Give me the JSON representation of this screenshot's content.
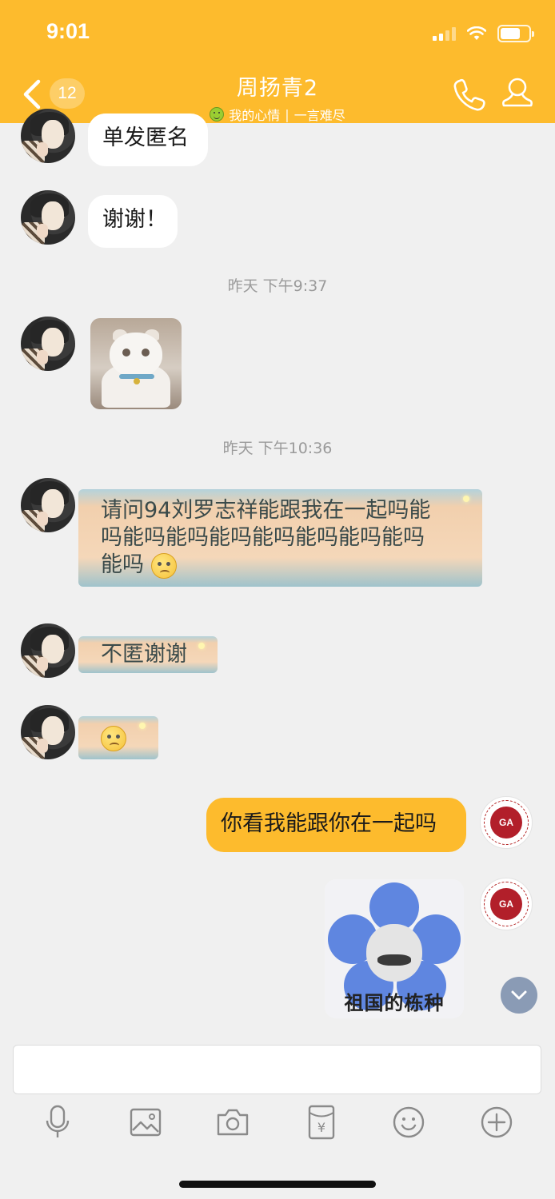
{
  "status_bar": {
    "time": "9:01",
    "battery_level": 0.72
  },
  "header": {
    "unread_count": "12",
    "title": "周扬青2",
    "subtitle_mood": "我的心情",
    "subtitle_separator": "|",
    "subtitle_status": "一言难尽"
  },
  "messages": [
    {
      "side": "in",
      "type": "text",
      "text": "单发匿名"
    },
    {
      "side": "in",
      "type": "text",
      "text": "谢谢！"
    },
    {
      "type": "timestamp",
      "text": "昨天 下午9:37"
    },
    {
      "side": "in",
      "type": "sticker",
      "sticker": "white-cat"
    },
    {
      "type": "timestamp",
      "text": "昨天 下午10:36"
    },
    {
      "side": "in",
      "type": "brush-text",
      "lines": [
        "请问94刘罗志祥能跟我在一起吗能",
        "吗能吗能吗能吗能吗能吗能吗能吗",
        "能吗"
      ],
      "emoji": "rolling-eyes"
    },
    {
      "side": "in",
      "type": "brush-text",
      "lines": [
        "不匿谢谢"
      ]
    },
    {
      "side": "in",
      "type": "brush-emoji",
      "emoji": "rolling-eyes"
    },
    {
      "side": "out",
      "type": "text",
      "text": "你看我能跟你在一起吗"
    },
    {
      "side": "out",
      "type": "sticker",
      "sticker": "blue-flower-face",
      "caption": "祖国的栋种"
    }
  ],
  "input": {
    "placeholder": ""
  },
  "toolbar": [
    "microphone-icon",
    "image-icon",
    "camera-icon",
    "red-packet-icon",
    "emoji-icon",
    "plus-icon"
  ],
  "colors": {
    "accent": "#fdbb2d",
    "background": "#f0f0f0",
    "bubble_in": "#ffffff",
    "bubble_out": "#fdbb2d"
  }
}
